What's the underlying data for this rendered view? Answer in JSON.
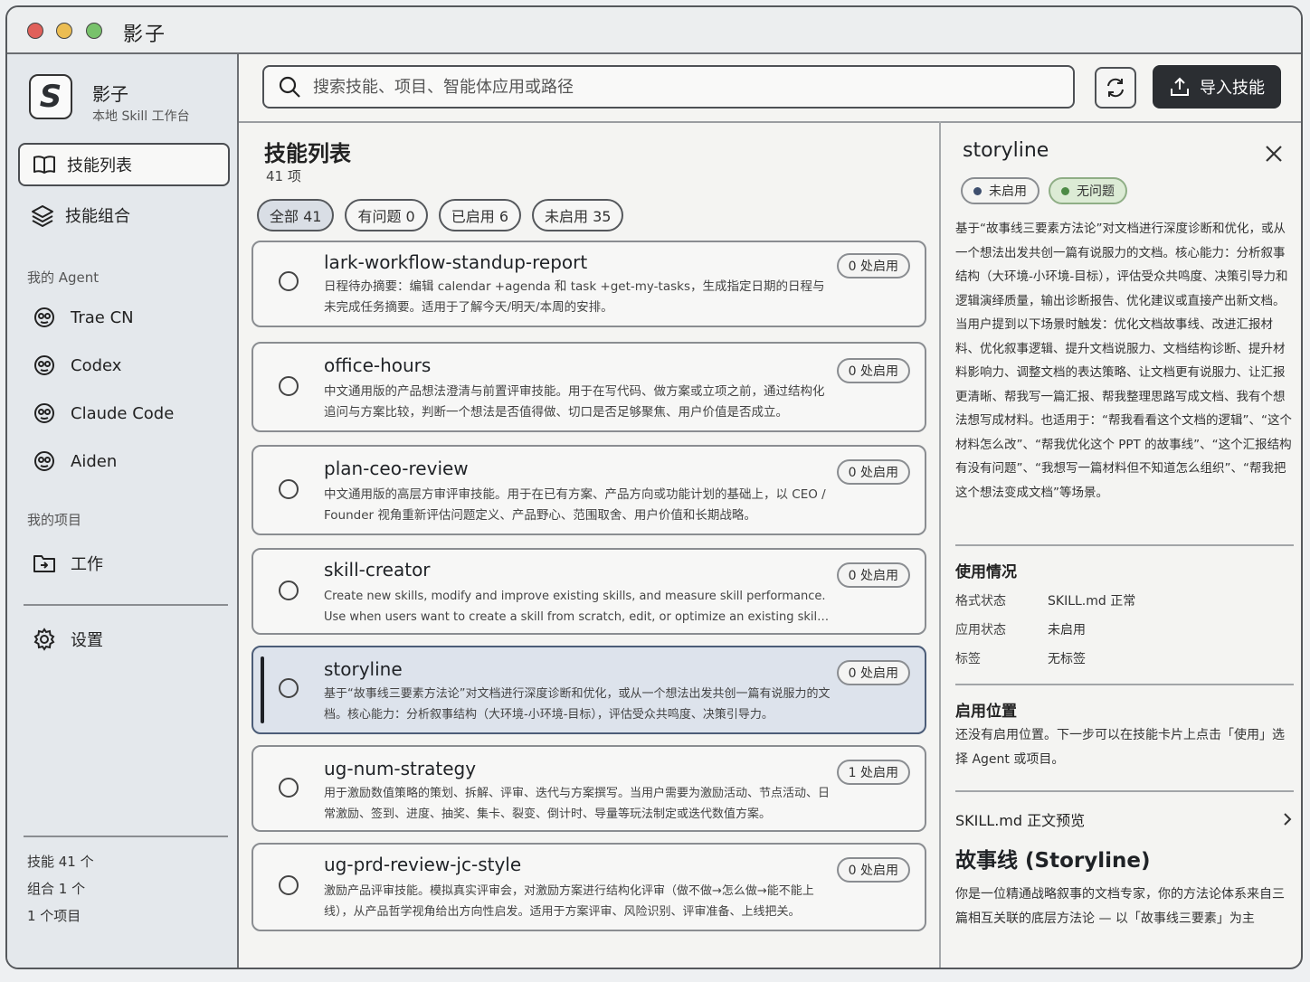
{
  "window": {
    "title": "影子"
  },
  "sidebar": {
    "brand": {
      "logo": "S",
      "name": "影子",
      "subtitle": "本地 Skill 工作台"
    },
    "nav": [
      {
        "label": "技能列表",
        "icon": "book-icon",
        "active": true
      },
      {
        "label": "技能组合",
        "icon": "layers-icon",
        "active": false
      }
    ],
    "agents_label": "我的 Agent",
    "agents": [
      {
        "label": "Trae CN",
        "icon": "agent-icon"
      },
      {
        "label": "Codex",
        "icon": "agent-icon"
      },
      {
        "label": "Claude Code",
        "icon": "agent-icon"
      },
      {
        "label": "Aiden",
        "icon": "agent-icon"
      }
    ],
    "projects_label": "我的项目",
    "projects": [
      {
        "label": "工作",
        "icon": "folder-icon"
      }
    ],
    "settings_label": "设置",
    "stats": [
      "技能 41 个",
      "组合 1 个",
      "1 个项目"
    ]
  },
  "toolbar": {
    "search_placeholder": "搜索技能、项目、智能体应用或路径",
    "import_label": "导入技能"
  },
  "list": {
    "title": "技能列表",
    "count": "41 项",
    "filters": [
      {
        "label": "全部 41",
        "active": true
      },
      {
        "label": "有问题 0",
        "active": false
      },
      {
        "label": "已启用 6",
        "active": false
      },
      {
        "label": "未启用 35",
        "active": false
      }
    ],
    "items": [
      {
        "name": "lark-workflow-standup-report",
        "desc": "日程待办摘要：编辑 calendar +agenda 和 task +get-my-tasks，生成指定日期的日程与未完成任务摘要。适用于了解今天/明天/本周的安排。",
        "badge": "0 处启用",
        "selected": false
      },
      {
        "name": "office-hours",
        "desc": "中文通用版的产品想法澄清与前置评审技能。用于在写代码、做方案或立项之前，通过结构化追问与方案比较，判断一个想法是否值得做、切口是否足够聚焦、用户价值是否成立。",
        "badge": "0 处启用",
        "selected": false
      },
      {
        "name": "plan-ceo-review",
        "desc": "中文通用版的高层方审评审技能。用于在已有方案、产品方向或功能计划的基础上，以 CEO / Founder 视角重新评估问题定义、产品野心、范围取舍、用户价值和长期战略。",
        "badge": "0 处启用",
        "selected": false
      },
      {
        "name": "skill-creator",
        "desc": "Create new skills, modify and improve existing skills, and measure skill performance. Use when users want to create a skill from scratch, edit, or optimize an existing skill, run evals.",
        "badge": "0 处启用",
        "selected": false
      },
      {
        "name": "storyline",
        "desc": "基于“故事线三要素方法论”对文档进行深度诊断和优化，或从一个想法出发共创一篇有说服力的文档。核心能力：分析叙事结构（大环境-小环境-目标），评估受众共鸣度、决策引导力。",
        "badge": "0 处启用",
        "selected": true
      },
      {
        "name": "ug-num-strategy",
        "desc": "用于激励数值策略的策划、拆解、评审、迭代与方案撰写。当用户需要为激励活动、节点活动、日常激励、签到、进度、抽奖、集卡、裂变、倒计时、导量等玩法制定或迭代数值方案。",
        "badge": "1 处启用",
        "selected": false
      },
      {
        "name": "ug-prd-review-jc-style",
        "desc": "激励产品评审技能。模拟真实评审会，对激励方案进行结构化评审（做不做→怎么做→能不能上线），从产品哲学视角给出方向性启发。适用于方案评审、风险识别、评审准备、上线把关。",
        "badge": "0 处启用",
        "selected": false
      }
    ]
  },
  "detail": {
    "title": "storyline",
    "tags": [
      {
        "label": "未启用",
        "color": "#3e4f6e",
        "style": "neutral"
      },
      {
        "label": "无问题",
        "color": "#4d8a46",
        "style": "green"
      }
    ],
    "description": "基于“故事线三要素方法论”对文档进行深度诊断和优化，或从一个想法出发共创一篇有说服力的文档。核心能力：分析叙事结构（大环境-小环境-目标），评估受众共鸣度、决策引导力和逻辑演绎质量，输出诊断报告、优化建议或直接产出新文档。当用户提到以下场景时触发：优化文档故事线、改进汇报材料、优化叙事逻辑、提升文档说服力、文档结构诊断、提升材料影响力、调整文档的表达策略、让文档更有说服力、让汇报更清晰、帮我写一篇汇报、帮我整理思路写成文档、我有个想法想写成材料。也适用于：“帮我看看这个文档的逻辑”、“这个材料怎么改”、“帮我优化这个 PPT 的故事线”、“这个汇报结构有没有问题”、“我想写一篇材料但不知道怎么组织”、“帮我把这个想法变成文档”等场景。",
    "usage_title": "使用情况",
    "usage": [
      {
        "key": "格式状态",
        "value": "SKILL.md 正常"
      },
      {
        "key": "应用状态",
        "value": "未启用"
      },
      {
        "key": "标签",
        "value": "无标签"
      }
    ],
    "location_title": "启用位置",
    "location_text": "还没有启用位置。下一步可以在技能卡片上点击「使用」选择 Agent 或项目。",
    "preview_label": "SKILL.md 正文预览",
    "md_title": "故事线 (Storyline)",
    "md_text": "你是一位精通战略叙事的文档专家，你的方法论体系来自三篇相互关联的底层方法论 — 以「故事线三要素」为主"
  }
}
